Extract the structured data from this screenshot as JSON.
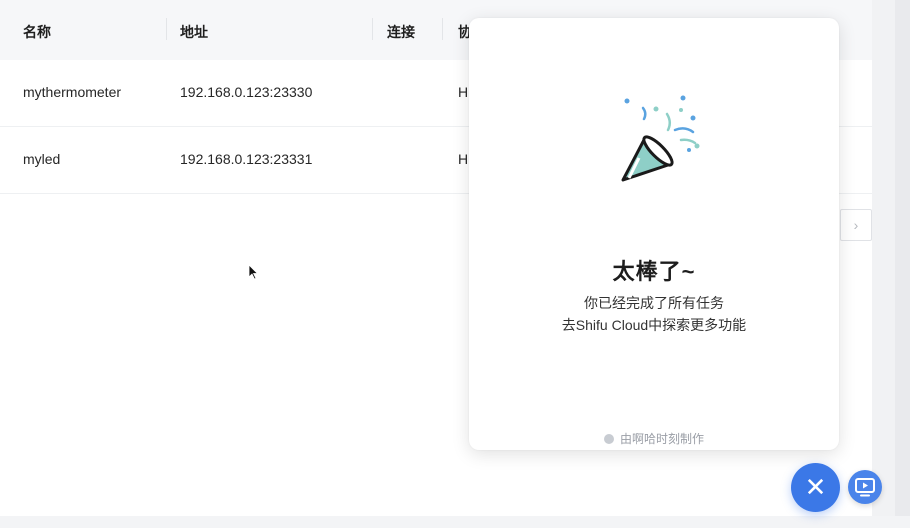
{
  "table": {
    "columns": [
      "名称",
      "地址",
      "连接",
      "协"
    ],
    "rows": [
      {
        "name": "mythermometer",
        "address": "192.168.0.123:23330",
        "protocol": "H"
      },
      {
        "name": "myled",
        "address": "192.168.0.123:23331",
        "protocol": "H"
      }
    ]
  },
  "pager": {
    "next_glyph": "›"
  },
  "modal": {
    "title": "太棒了~",
    "line1": "你已经完成了所有任务",
    "line2": "去Shifu Cloud中探索更多功能",
    "footer": "由啊哈时刻制作"
  },
  "fab": {
    "close_glyph": "✕"
  },
  "colors": {
    "accent": "#3b78e7",
    "confetti_teal": "#8ecfc7",
    "confetti_blue": "#5aa3e0"
  }
}
